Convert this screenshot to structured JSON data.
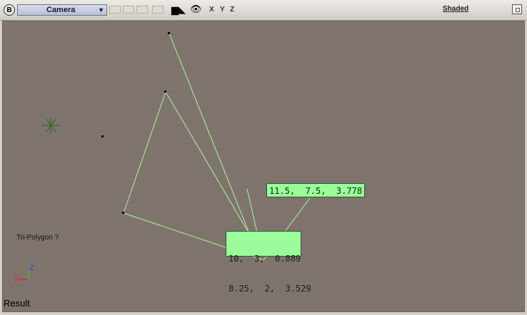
{
  "toolbar": {
    "camera_label": "Camera",
    "axis_x": "X",
    "axis_y": "Y",
    "axis_z": "Z",
    "shading_label": "Shaded",
    "b_button": "B"
  },
  "viewport": {
    "points_tag_top": "11.5,  7.5,  3.778",
    "points_tag_line1": "10,  3,  0.889",
    "points_tag_line2": "8.25,  2,  3.529",
    "selection_label": "Tri-Polygon ?",
    "status": "Result",
    "gizmo_x": "X",
    "gizmo_z": "Z"
  },
  "colors": {
    "viewport_bg": "#7f746d",
    "edge": "#a8f59c",
    "tag_bg": "#9afc9a",
    "axis_x": "#e02a2a",
    "axis_y": "#2ad32a",
    "axis_z": "#2a4adf"
  },
  "icons": [
    "camera-icon",
    "eye-icon",
    "maximize-icon"
  ]
}
